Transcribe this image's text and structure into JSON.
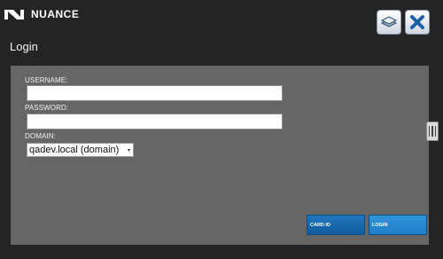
{
  "brand": {
    "logo_text": "NUANCE"
  },
  "page": {
    "title": "Login"
  },
  "toolbar": {
    "layers_icon": "layers-icon",
    "close_icon": "close-icon"
  },
  "form": {
    "username": {
      "label": "USERNAME:",
      "value": ""
    },
    "password": {
      "label": "PASSWORD:",
      "value": ""
    },
    "domain": {
      "label": "DOMAIN:",
      "selected": "qadev.local (domain)"
    }
  },
  "actions": {
    "card_id": "CARD ID",
    "login": "LOGIN"
  },
  "colors": {
    "background": "#242424",
    "panel": "#666666",
    "accent": "#1f80c8"
  }
}
